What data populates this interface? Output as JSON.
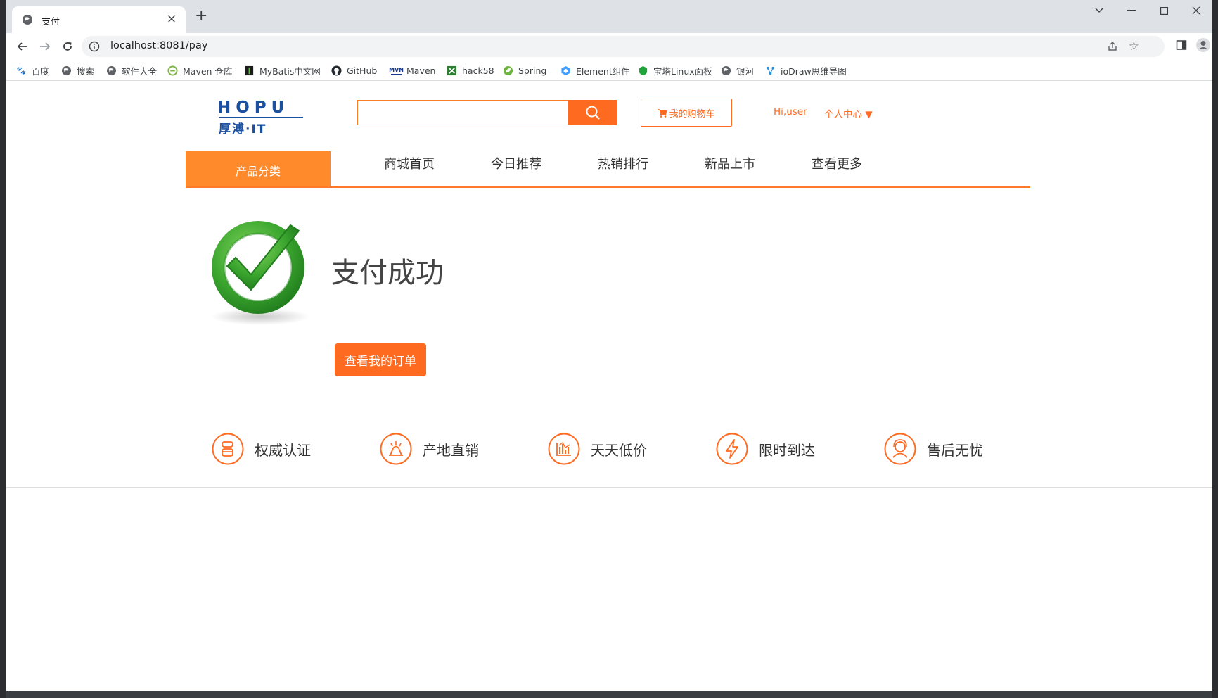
{
  "tab": {
    "title": "支付",
    "close": "×",
    "new_tab": "+"
  },
  "window_controls": {
    "search": "⌄",
    "minimize": "—",
    "maximize": "☐",
    "close": "✕"
  },
  "omnibox": {
    "url": "localhost:8081/pay"
  },
  "bookmarks": [
    {
      "label": "百度",
      "icon": "baidu-icon",
      "color": "#2932e1"
    },
    {
      "label": "搜索",
      "icon": "globe-icon",
      "color": "#5f6368"
    },
    {
      "label": "软件大全",
      "icon": "globe-icon",
      "color": "#5f6368"
    },
    {
      "label": "Maven 仓库",
      "icon": "maven-repo-icon",
      "color": "#7cb342"
    },
    {
      "label": "MyBatis中文网",
      "icon": "mybatis-icon",
      "color": "#1b1b1b"
    },
    {
      "label": "GitHub",
      "icon": "github-icon",
      "color": "#24292f"
    },
    {
      "label": "Maven",
      "icon": "maven-icon",
      "color": "#1a3b8c"
    },
    {
      "label": "hack58",
      "icon": "hack58-icon",
      "color": "#2e7d32"
    },
    {
      "label": "Spring",
      "icon": "spring-icon",
      "color": "#6db33f"
    },
    {
      "label": "Element组件",
      "icon": "element-icon",
      "color": "#409eff"
    },
    {
      "label": "宝塔Linux面板",
      "icon": "bt-icon",
      "color": "#20a53a"
    },
    {
      "label": "银河",
      "icon": "globe-icon",
      "color": "#5f6368"
    },
    {
      "label": "ioDraw思维导图",
      "icon": "iodraw-icon",
      "color": "#2c8fd6"
    }
  ],
  "header": {
    "logo_top": "HOPU",
    "logo_bottom": "厚溥·IT",
    "search_placeholder": "",
    "cart_label": "我的购物车",
    "greeting": "Hi,user",
    "user_center": "个人中心 ▼"
  },
  "nav": {
    "category": "产品分类",
    "items": [
      "商城首页",
      "今日推荐",
      "热销排行",
      "新品上市",
      "查看更多"
    ]
  },
  "main": {
    "title": "支付成功",
    "orders_button": "查看我的订单"
  },
  "features": [
    {
      "label": "权威认证",
      "icon": "certificate-icon"
    },
    {
      "label": "产地直销",
      "icon": "origin-icon"
    },
    {
      "label": "天天低价",
      "icon": "low-price-icon"
    },
    {
      "label": "限时到达",
      "icon": "lightning-icon"
    },
    {
      "label": "售后无忧",
      "icon": "customer-service-icon"
    }
  ],
  "colors": {
    "accent": "#ff6a21",
    "category": "#ff8a2b",
    "logo": "#1b4fa0",
    "success": "#3aa52e"
  }
}
